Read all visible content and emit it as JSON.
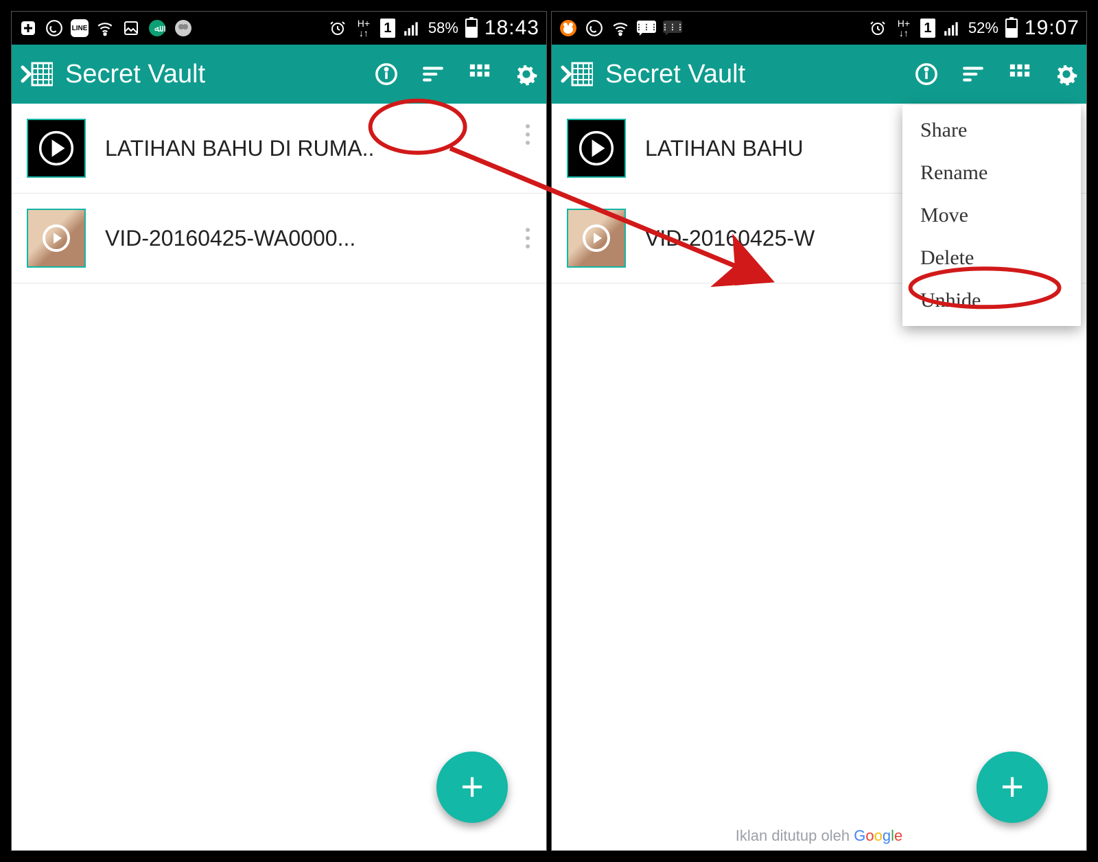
{
  "left": {
    "statusbar": {
      "battery_pct": "58%",
      "time": "18:43",
      "sim_label": "1",
      "h_label": "H+↓↑"
    },
    "toolbar": {
      "title": "Secret Vault"
    },
    "items": [
      {
        "label": "LATIHAN BAHU DI RUMA.."
      },
      {
        "label": "VID-20160425-WA0000..."
      }
    ],
    "fab": "+"
  },
  "right": {
    "statusbar": {
      "battery_pct": "52%",
      "time": "19:07",
      "sim_label": "1",
      "h_label": "H+↓↑"
    },
    "toolbar": {
      "title": "Secret Vault"
    },
    "items": [
      {
        "label": "LATIHAN BAHU"
      },
      {
        "label": "VID-20160425-W"
      }
    ],
    "menu": {
      "share": "Share",
      "rename": "Rename",
      "move": "Move",
      "delete": "Delete",
      "unhide": "Unhide"
    },
    "ad": {
      "text": "Iklan ditutup oleh ",
      "brand": "Google"
    },
    "fab": "+"
  },
  "colors": {
    "accent": "#0f9c8e",
    "fab": "#13b8a6",
    "annotation": "#d11919"
  }
}
